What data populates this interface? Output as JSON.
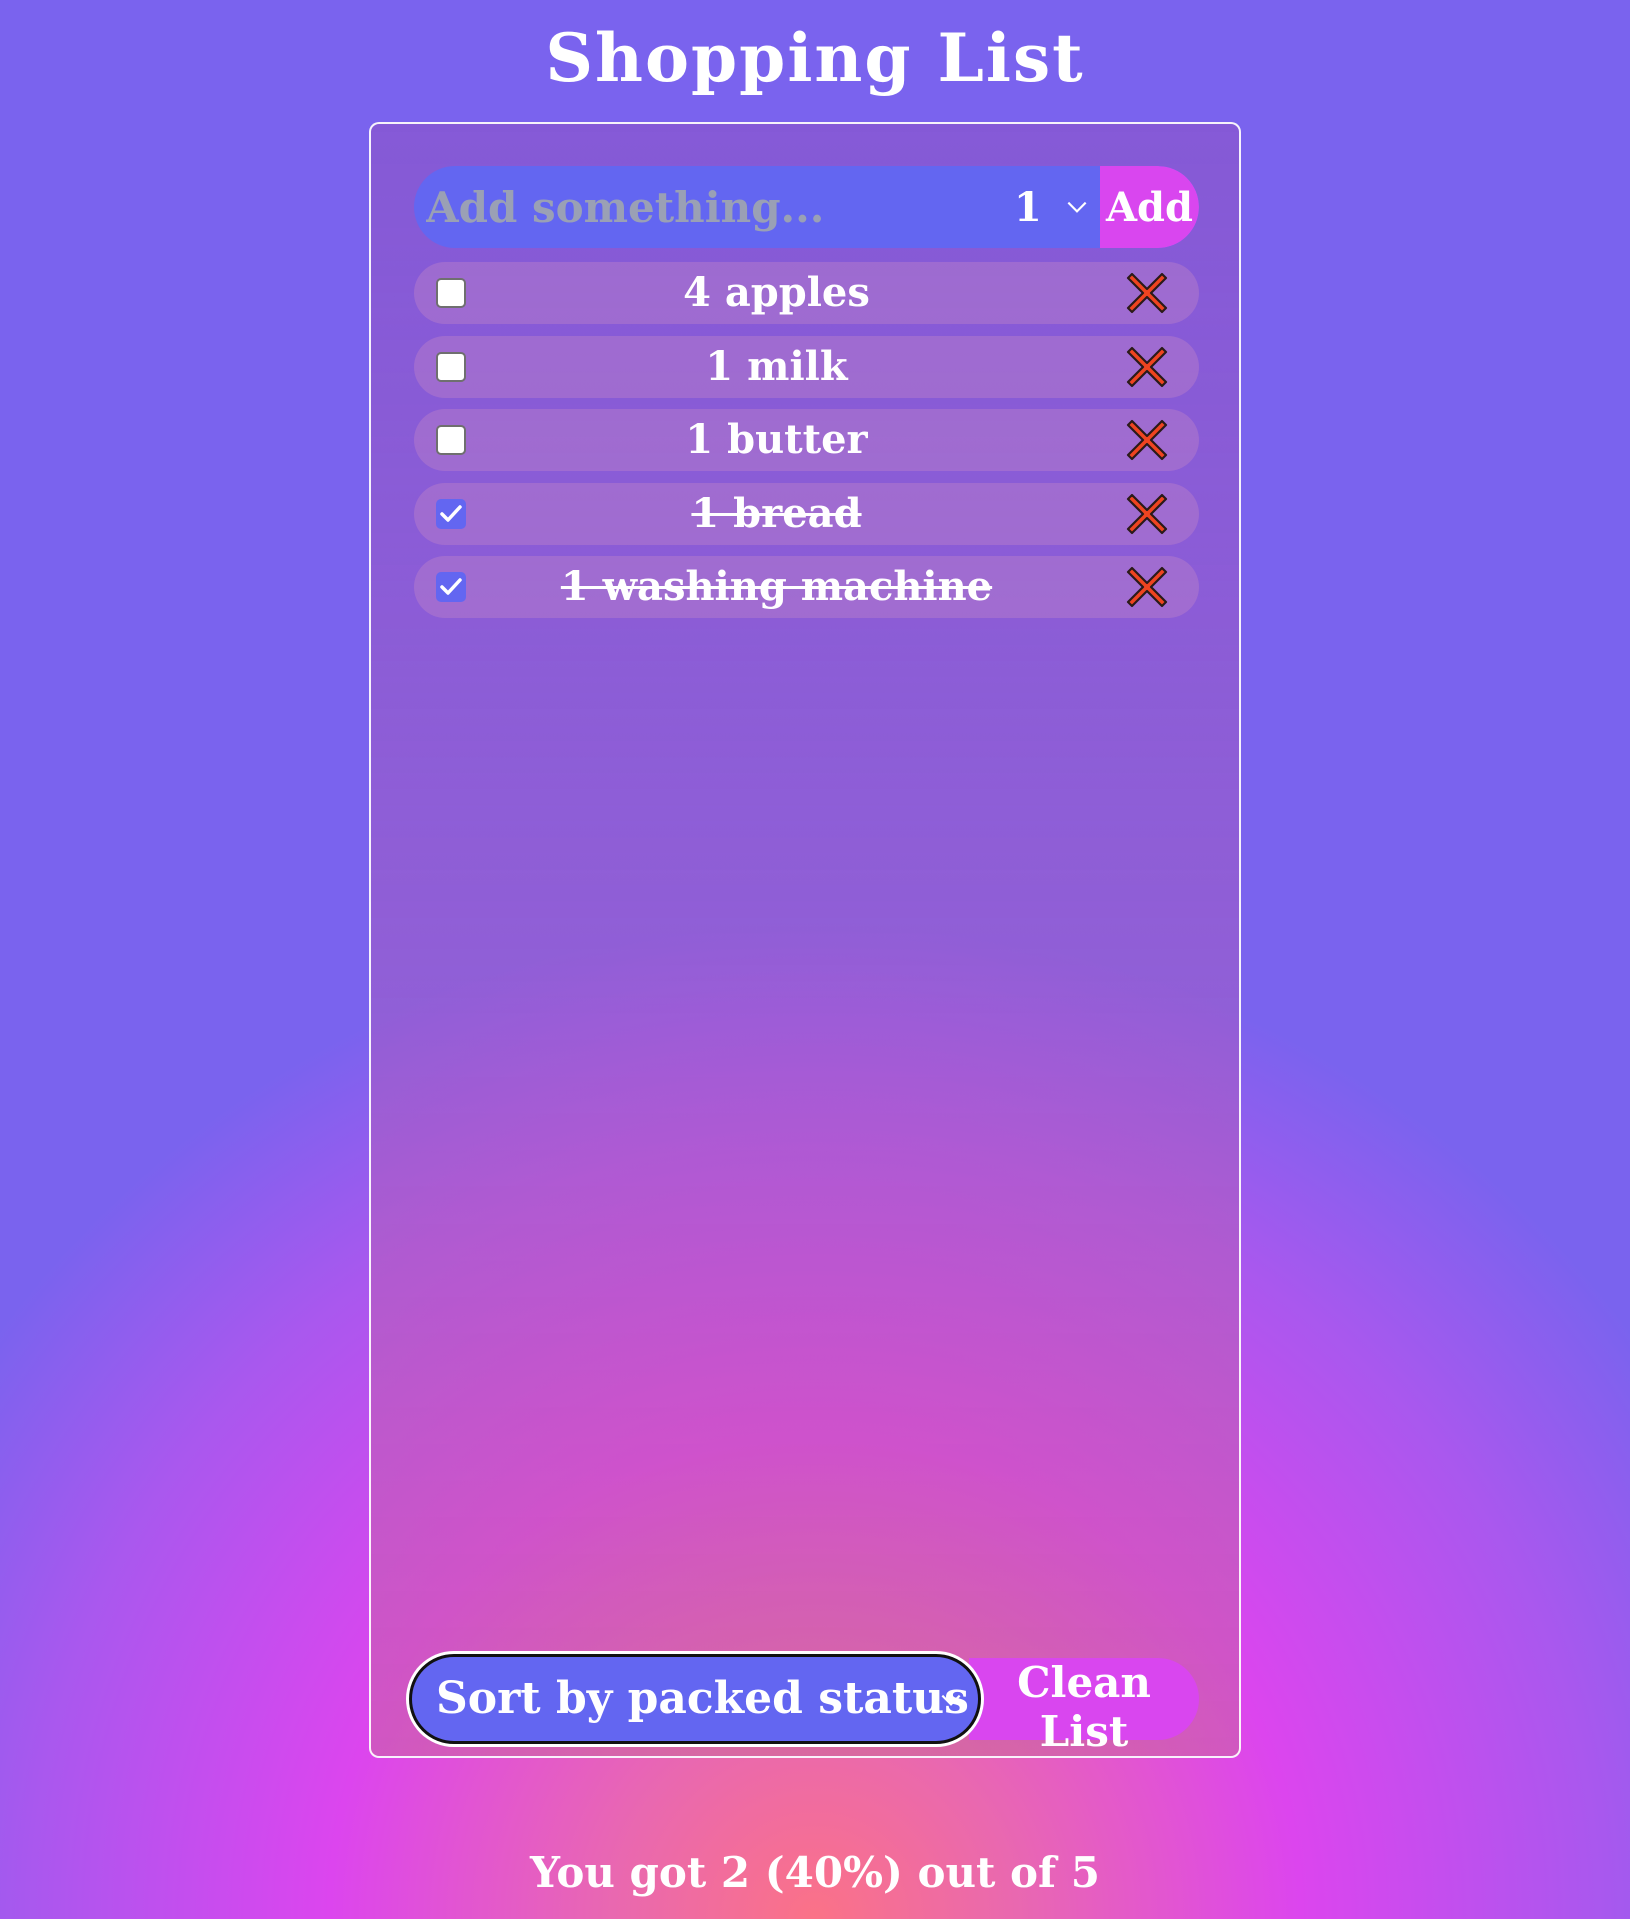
{
  "app": {
    "title": "Shopping List"
  },
  "add_form": {
    "input_placeholder": "Add something...",
    "input_value": "",
    "quantity_value": "1",
    "add_label": "Add"
  },
  "items": [
    {
      "label": "4 apples",
      "packed": false
    },
    {
      "label": "1 milk",
      "packed": false
    },
    {
      "label": "1 butter",
      "packed": false
    },
    {
      "label": "1 bread",
      "packed": true
    },
    {
      "label": "1 washing machine",
      "packed": true
    }
  ],
  "controls": {
    "sort_value": "Sort by packed status",
    "clean_label": "Clean List"
  },
  "stats": {
    "text": "You got 2 (40%) out of 5"
  },
  "colors": {
    "primary": "#6366f1",
    "accent": "#d946ef",
    "delete": "#ef4420"
  },
  "icons": {
    "delete": "close-x-icon",
    "check": "checkmark-icon",
    "dropdown": "chevron-down-icon"
  }
}
